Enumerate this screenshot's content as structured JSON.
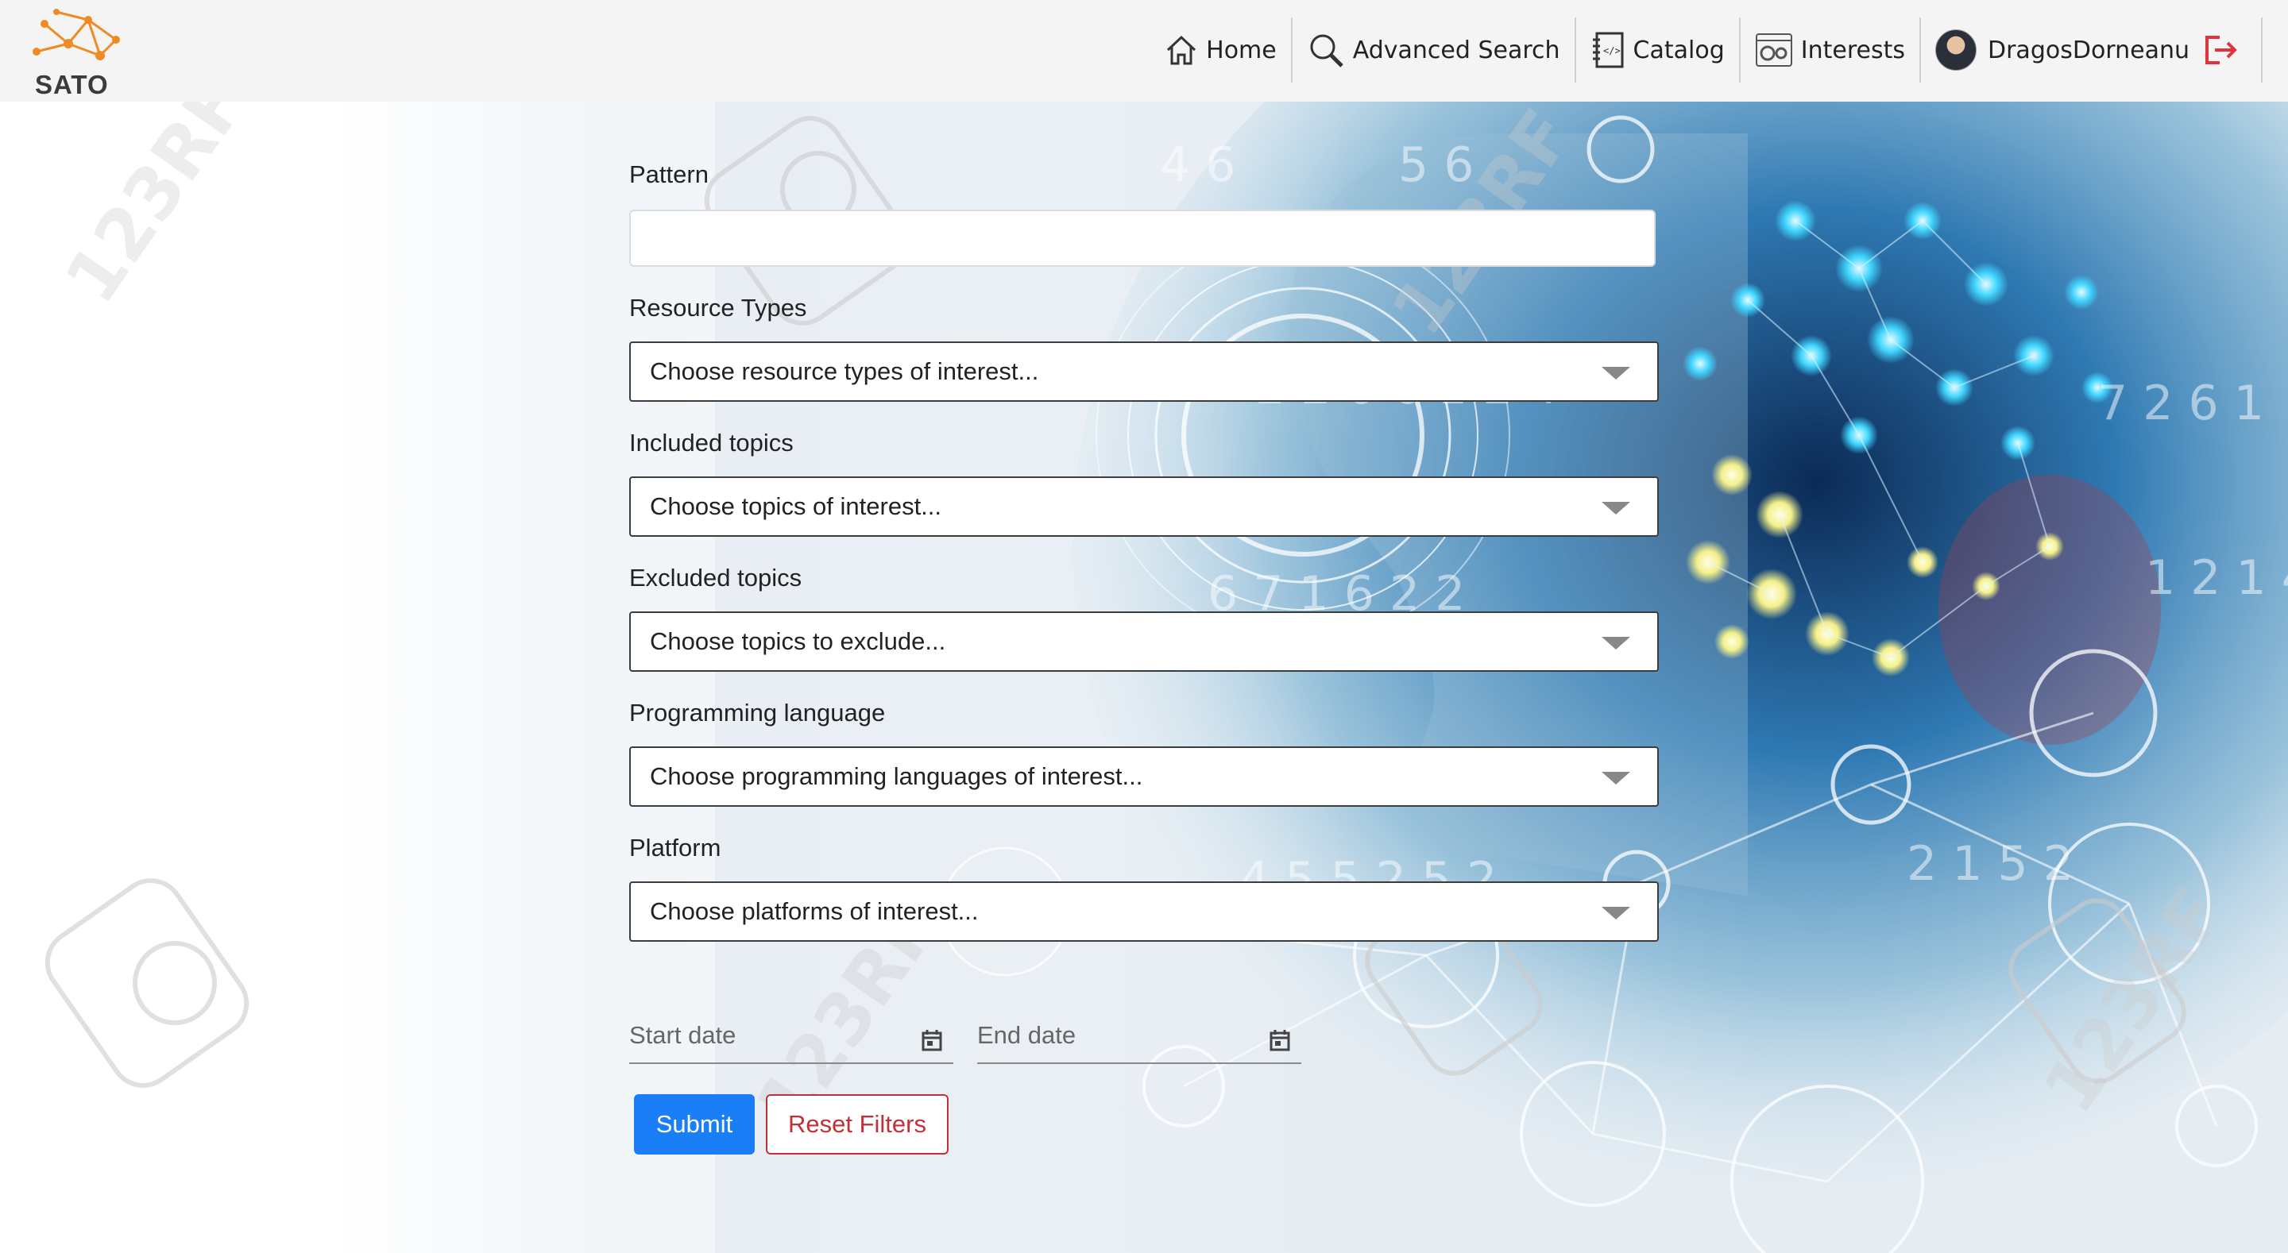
{
  "app": {
    "logo_text": "SATO"
  },
  "nav": {
    "home": "Home",
    "advanced_search": "Advanced Search",
    "catalog": "Catalog",
    "interests": "Interests",
    "user_name": "DragosDorneanu"
  },
  "form": {
    "pattern_label": "Pattern",
    "pattern_value": "",
    "resource_types_label": "Resource Types",
    "resource_types_placeholder": "Choose resource types of interest...",
    "included_topics_label": "Included topics",
    "included_topics_placeholder": "Choose topics of interest...",
    "excluded_topics_label": "Excluded topics",
    "excluded_topics_placeholder": "Choose topics to exclude...",
    "programming_language_label": "Programming language",
    "programming_language_placeholder": "Choose programming languages of interest...",
    "platform_label": "Platform",
    "platform_placeholder": "Choose platforms of interest...",
    "start_date_placeholder": "Start date",
    "end_date_placeholder": "End date",
    "submit_label": "Submit",
    "reset_label": "Reset Filters"
  },
  "colors": {
    "accent": "#1a7ef6",
    "danger": "#c0313a",
    "logo_orange": "#f08a24"
  },
  "icons": [
    "house-icon",
    "magnifier-icon",
    "notebook-icon",
    "gears-icon",
    "logout-icon",
    "calendar-icon"
  ]
}
